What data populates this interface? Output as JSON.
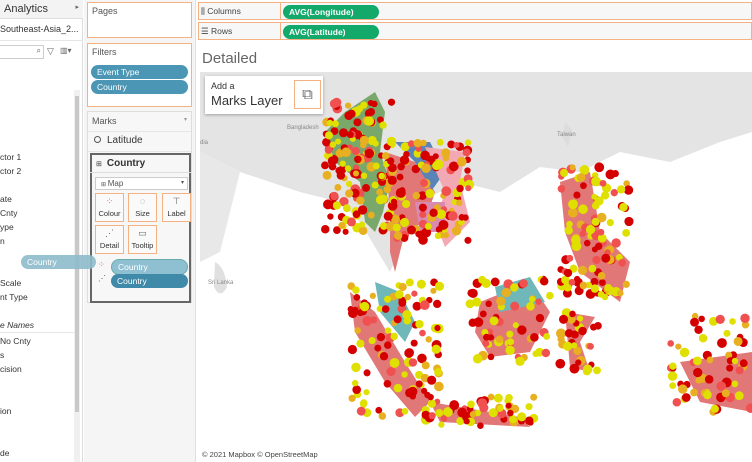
{
  "left_pane": {
    "header": "Analytics",
    "datasource": "Southeast-Asia_2...",
    "fields": [
      "ctor 1",
      "ctor 2",
      "ate",
      " Cnty",
      "ype",
      "n",
      "Scale",
      "nt Type",
      "e Names",
      "No Cnty",
      "s",
      "cision",
      "ion",
      "de"
    ]
  },
  "drag_pill": "Country",
  "pages": {
    "title": "Pages"
  },
  "filters": {
    "title": "Filters",
    "items": [
      "Event Type",
      "Country"
    ]
  },
  "marks": {
    "title": "Marks",
    "layer1": "Latitude",
    "layer2": "Country",
    "mark_type": "Map",
    "buttons": [
      "Colour",
      "Size",
      "Label",
      "Detail",
      "Tooltip"
    ],
    "pills": [
      {
        "label": "Country",
        "role": "colour"
      },
      {
        "label": "Country",
        "role": "detail"
      }
    ]
  },
  "columns": {
    "label": "Columns",
    "pill": "AVG(Longitude)"
  },
  "rows": {
    "label": "Rows",
    "pill": "AVG(Latitude)"
  },
  "sheet_title": "Detailed",
  "add_layer": {
    "line1": "Add a",
    "line2": "Marks Layer"
  },
  "map": {
    "labels": [
      "Bangladesh",
      "Taiwan",
      "Sri Lanka",
      "dia"
    ],
    "attribution": "© 2021 Mapbox © OpenStreetMap"
  },
  "colors": {
    "shelf_border": "#f4b183",
    "pill_blue": "#4a96b4",
    "pill_green": "#12a96b",
    "dot_red": "#d40000",
    "dot_yellow": "#e0e000"
  }
}
